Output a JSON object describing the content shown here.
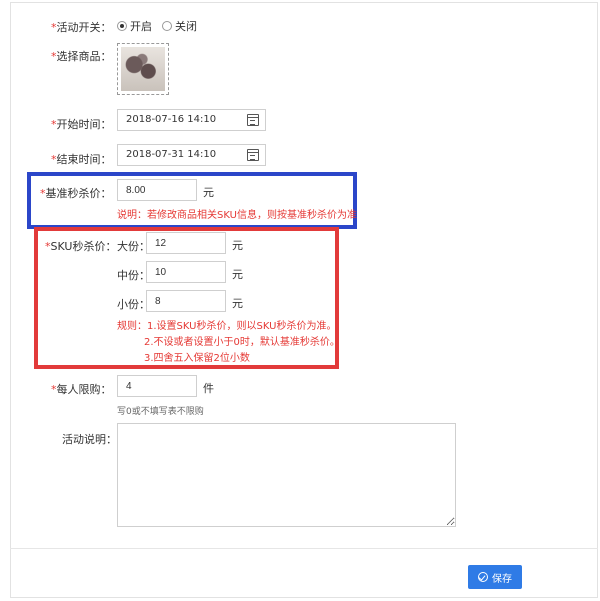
{
  "activity_switch": {
    "label": "活动开关：",
    "options": [
      {
        "label": "开启",
        "selected": true
      },
      {
        "label": "关闭",
        "selected": false
      }
    ]
  },
  "product": {
    "label": "选择商品："
  },
  "start_time": {
    "label": "开始时间：",
    "value": "2018-07-16 14:10"
  },
  "end_time": {
    "label": "结束时间：",
    "value": "2018-07-31 14:10"
  },
  "base_price": {
    "label": "基准秒杀价：",
    "value": "8.00",
    "unit": "元",
    "note": "说明：若修改商品相关SKU信息，则按基准秒杀价为准"
  },
  "sku_price": {
    "label": "SKU秒杀价：",
    "rows": [
      {
        "name": "大份：",
        "value": "12",
        "unit": "元"
      },
      {
        "name": "中份：",
        "value": "10",
        "unit": "元"
      },
      {
        "name": "小份：",
        "value": "8",
        "unit": "元"
      }
    ],
    "rules": [
      "规则：1.设置SKU秒杀价，则以SKU秒杀价为准。",
      "2.不设或者设置小于0时，默认基准秒杀价。",
      "3.四舍五入保留2位小数"
    ]
  },
  "limit": {
    "label": "每人限购：",
    "value": "4",
    "unit": "件",
    "hint": "写0或不填写表不限购"
  },
  "description": {
    "label": "活动说明："
  },
  "save_label": "保存",
  "required_mark": "*",
  "colors": {
    "highlight_blue": "#2b46c9",
    "highlight_red": "#e23a3a",
    "primary": "#2f7be6"
  }
}
